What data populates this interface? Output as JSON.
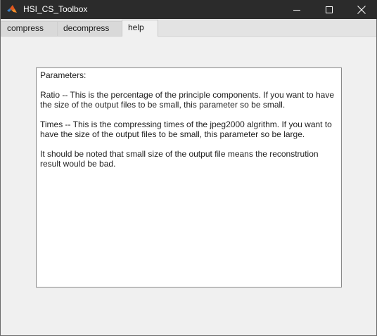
{
  "window": {
    "title": "HSI_CS_Toolbox",
    "icon": "matlab-logo-icon",
    "controls": {
      "minimize": "minimize-icon",
      "maximize": "maximize-icon",
      "close": "close-icon"
    }
  },
  "tabs": [
    {
      "label": "compress",
      "active": false
    },
    {
      "label": "decompress",
      "active": false
    },
    {
      "label": "help",
      "active": true
    }
  ],
  "help": {
    "heading": "Parameters:",
    "ratio": "Ratio -- This is the percentage of the principle components. If you want to have the size of the output files to be small, this parameter so be small.",
    "times": "Times -- This is the compressing times of the jpeg2000 algrithm. If you want to have the size of the output files to be small, this parameter so be large.",
    "note": "It should be noted that small size of the output file means the reconstrution result would be bad."
  },
  "colors": {
    "titlebar": "#2b2b2b",
    "background": "#f0f0f0",
    "text_box": "#ffffff"
  }
}
